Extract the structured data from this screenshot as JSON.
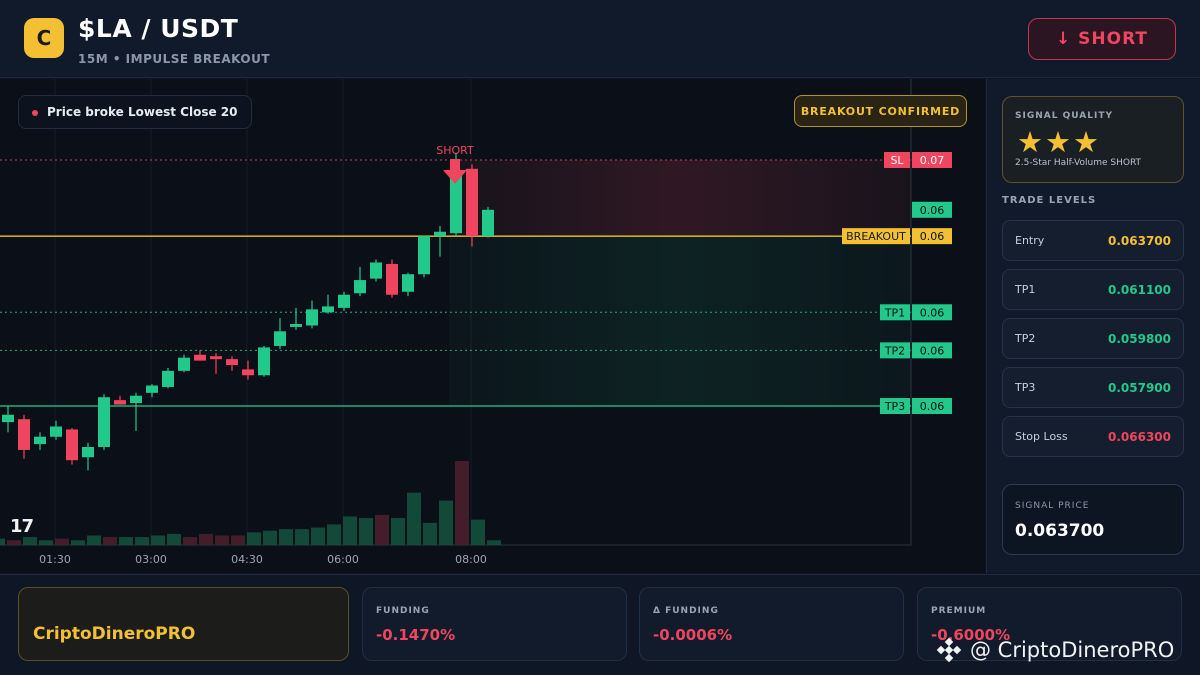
{
  "header": {
    "logo_letter": "C",
    "pair": "$LA / USDT",
    "subtitle": "15M • IMPULSE BREAKOUT",
    "action_label": "↓ SHORT"
  },
  "chart_overlay": {
    "info_pill": "Price broke Lowest Close 20",
    "confirmed_badge": "BREAKOUT CONFIRMED",
    "short_marker": "SHORT",
    "tv_logo": "17"
  },
  "chart_data": {
    "type": "candlestick",
    "x_ticks": [
      "01:30",
      "03:00",
      "04:30",
      "06:00",
      "08:00"
    ],
    "candles": [
      {
        "o": 0.05735,
        "h": 0.0579,
        "l": 0.057,
        "c": 0.0576
      },
      {
        "o": 0.05745,
        "h": 0.0576,
        "l": 0.0561,
        "c": 0.0564
      },
      {
        "o": 0.0566,
        "h": 0.057,
        "l": 0.0564,
        "c": 0.05685
      },
      {
        "o": 0.05685,
        "h": 0.0574,
        "l": 0.05675,
        "c": 0.0572
      },
      {
        "o": 0.0571,
        "h": 0.05715,
        "l": 0.0559,
        "c": 0.05605
      },
      {
        "o": 0.05615,
        "h": 0.05665,
        "l": 0.0557,
        "c": 0.0565
      },
      {
        "o": 0.0565,
        "h": 0.0583,
        "l": 0.0564,
        "c": 0.0582
      },
      {
        "o": 0.0581,
        "h": 0.05825,
        "l": 0.05795,
        "c": 0.05795
      },
      {
        "o": 0.058,
        "h": 0.05835,
        "l": 0.05705,
        "c": 0.05825
      },
      {
        "o": 0.05835,
        "h": 0.05865,
        "l": 0.0582,
        "c": 0.0586
      },
      {
        "o": 0.05855,
        "h": 0.0592,
        "l": 0.0585,
        "c": 0.0591
      },
      {
        "o": 0.0591,
        "h": 0.05965,
        "l": 0.05905,
        "c": 0.05955
      },
      {
        "o": 0.05965,
        "h": 0.0598,
        "l": 0.05945,
        "c": 0.05945
      },
      {
        "o": 0.0596,
        "h": 0.0597,
        "l": 0.059,
        "c": 0.0595
      },
      {
        "o": 0.0595,
        "h": 0.0596,
        "l": 0.0591,
        "c": 0.0593
      },
      {
        "o": 0.05915,
        "h": 0.05945,
        "l": 0.0588,
        "c": 0.05895
      },
      {
        "o": 0.05895,
        "h": 0.05995,
        "l": 0.0589,
        "c": 0.0599
      },
      {
        "o": 0.05995,
        "h": 0.0609,
        "l": 0.05985,
        "c": 0.06045
      },
      {
        "o": 0.0606,
        "h": 0.06125,
        "l": 0.0605,
        "c": 0.0607
      },
      {
        "o": 0.06065,
        "h": 0.0615,
        "l": 0.06055,
        "c": 0.0612
      },
      {
        "o": 0.0611,
        "h": 0.0617,
        "l": 0.06105,
        "c": 0.0613
      },
      {
        "o": 0.06125,
        "h": 0.0618,
        "l": 0.06115,
        "c": 0.0617
      },
      {
        "o": 0.06175,
        "h": 0.06265,
        "l": 0.06165,
        "c": 0.0622
      },
      {
        "o": 0.06225,
        "h": 0.0629,
        "l": 0.06215,
        "c": 0.0628
      },
      {
        "o": 0.06275,
        "h": 0.0629,
        "l": 0.0616,
        "c": 0.0617
      },
      {
        "o": 0.0618,
        "h": 0.06245,
        "l": 0.06165,
        "c": 0.0624
      },
      {
        "o": 0.0624,
        "h": 0.0637,
        "l": 0.0623,
        "c": 0.0637
      },
      {
        "o": 0.0637,
        "h": 0.06405,
        "l": 0.063,
        "c": 0.06385
      },
      {
        "o": 0.0638,
        "h": 0.06655,
        "l": 0.0637,
        "c": 0.06595
      },
      {
        "o": 0.066,
        "h": 0.06615,
        "l": 0.06335,
        "c": 0.0637
      },
      {
        "o": 0.0637,
        "h": 0.0647,
        "l": 0.06365,
        "c": 0.0646
      }
    ],
    "volumes": [
      4,
      3,
      5,
      3,
      4,
      3,
      6,
      5,
      5,
      5,
      6,
      7,
      5,
      7,
      6,
      6,
      8,
      9,
      10,
      10,
      11,
      13,
      18,
      17,
      19,
      17,
      33,
      14,
      28,
      53,
      16,
      3
    ],
    "levels": [
      {
        "name": "SL",
        "label": "SL",
        "value": 0.0663,
        "tag": "0.07",
        "color": "#f0455e"
      },
      {
        "name": "breakout",
        "label": "BREAKOUT",
        "value": 0.0637,
        "tag": "0.06",
        "color": "#f3c034"
      },
      {
        "name": "tp1",
        "label": "TP1",
        "value": 0.0611,
        "tag": "0.06",
        "color": "#22c98a"
      },
      {
        "name": "tp2",
        "label": "TP2",
        "value": 0.0598,
        "tag": "0.06",
        "color": "#22c98a"
      },
      {
        "name": "tp3",
        "label": "TP3",
        "value": 0.0579,
        "tag": "0.06",
        "color": "#22c98a"
      }
    ],
    "current_price_tag": "0.06",
    "current_price": 0.0646,
    "ylim": [
      0.0552,
      0.0672
    ],
    "up_color": "#22c98a",
    "down_color": "#f0455e"
  },
  "sidebar": {
    "quality_label": "SIGNAL QUALITY",
    "stars": "★★★",
    "quality_desc": "2.5-Star Half-Volume SHORT",
    "trade_levels_title": "TRADE LEVELS",
    "levels": [
      {
        "name": "Entry",
        "value": "0.063700",
        "color": "#f3c034"
      },
      {
        "name": "TP1",
        "value": "0.061100",
        "color": "#22c98a"
      },
      {
        "name": "TP2",
        "value": "0.059800",
        "color": "#22c98a"
      },
      {
        "name": "TP3",
        "value": "0.057900",
        "color": "#22c98a"
      },
      {
        "name": "Stop Loss",
        "value": "0.066300",
        "color": "#f0455e"
      }
    ],
    "signal_price_label": "SIGNAL PRICE",
    "signal_price": "0.063700"
  },
  "footer": {
    "brand": "CriptoDineroPRO",
    "metrics": [
      {
        "label": "FUNDING",
        "value": "-0.1470%"
      },
      {
        "label": "Δ FUNDING",
        "value": "-0.0006%"
      },
      {
        "label": "PREMIUM",
        "value": "-0.6000%"
      }
    ],
    "watermark": "@ CriptoDineroPRO"
  }
}
